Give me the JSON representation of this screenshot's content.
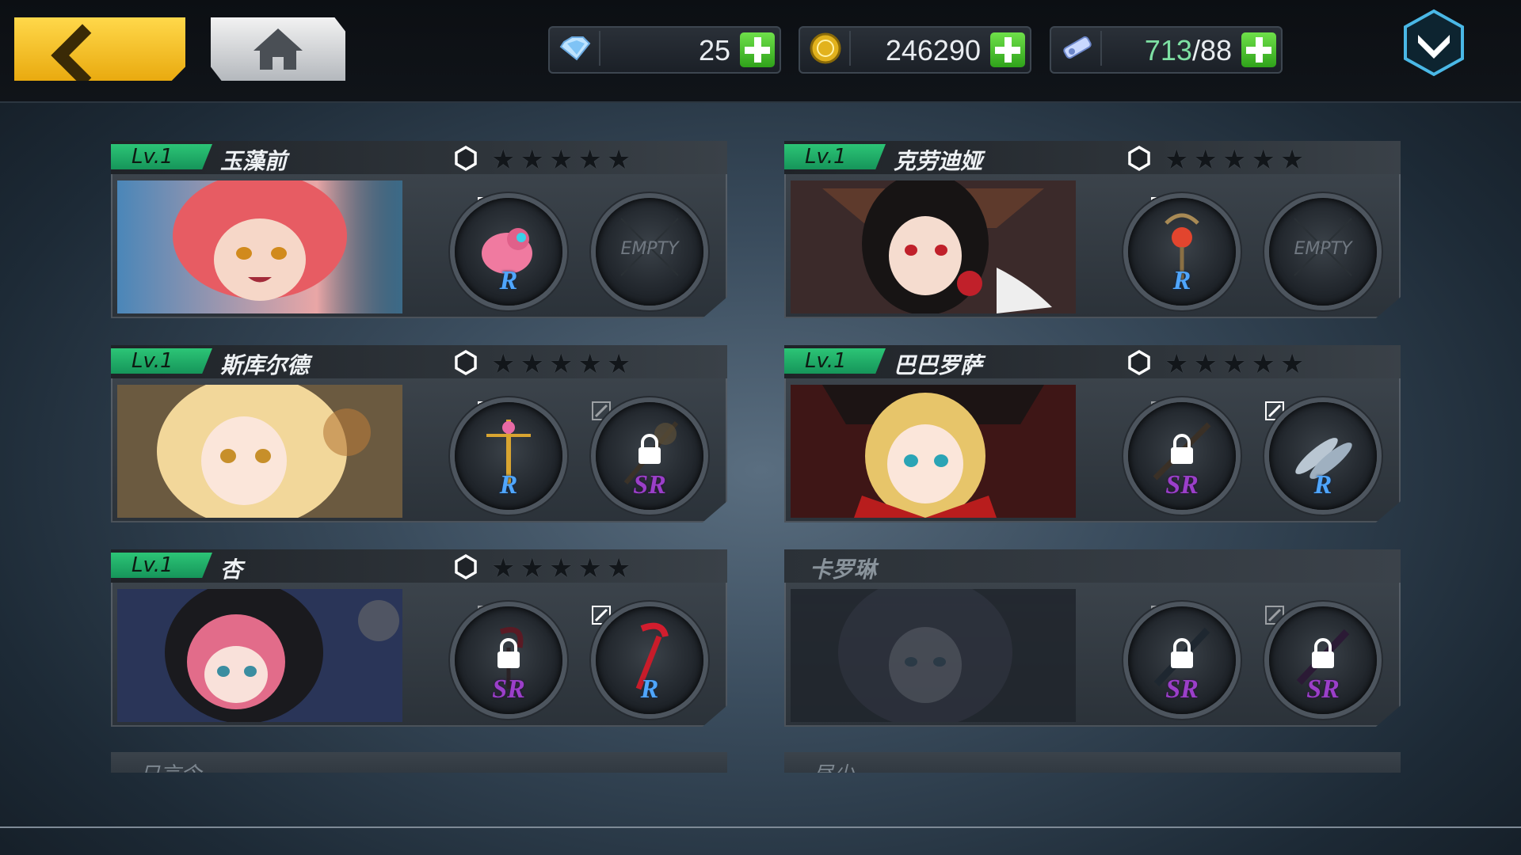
{
  "resources": {
    "gems": "25",
    "gold": "246290",
    "stamina_current": "713",
    "stamina_sep_max": "/88"
  },
  "colors": {
    "level_green": "#22b36a",
    "accent_yellow": "#f5c026",
    "rarity_r": "#4fa6ff",
    "rarity_sr": "#9b3fc9"
  },
  "characters": [
    {
      "level": "Lv.1",
      "name": "玉藻前",
      "stars": "★★★★★",
      "slot1": "R",
      "slot2": "EMPTY"
    },
    {
      "level": "Lv.1",
      "name": "克劳迪娅",
      "stars": "★★★★★",
      "slot1": "R",
      "slot2": "EMPTY"
    },
    {
      "level": "Lv.1",
      "name": "斯库尔德",
      "stars": "★★★★★",
      "slot1": "R",
      "slot2": "SR"
    },
    {
      "level": "Lv.1",
      "name": "巴巴罗萨",
      "stars": "★★★★★",
      "slot1": "SR",
      "slot2": "R"
    },
    {
      "level": "Lv.1",
      "name": "杏",
      "stars": "★★★★★",
      "slot1": "SR",
      "slot2": "R"
    },
    {
      "level": "",
      "name": "卡罗琳",
      "stars": "",
      "slot1": "SR",
      "slot2": "SR"
    }
  ],
  "partial_cards": [
    "日言令",
    "昼少"
  ]
}
